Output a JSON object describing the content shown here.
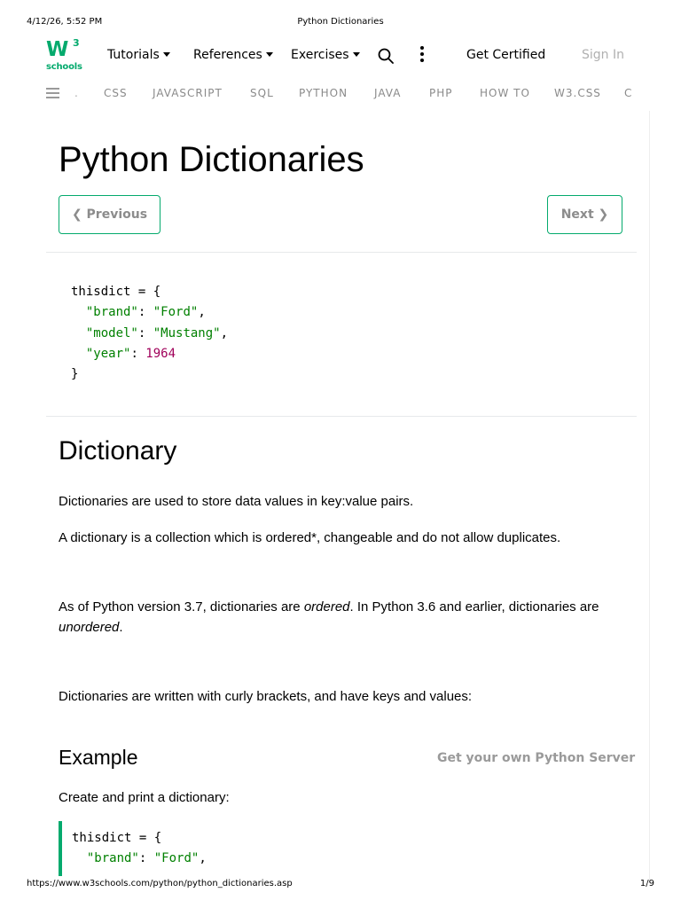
{
  "print_header": {
    "date": "4/12/26, 5:52 PM",
    "title": "Python Dictionaries"
  },
  "logo": {
    "w": "W",
    "sup": "3",
    "schools": "schools"
  },
  "topnav": {
    "tutorials": "Tutorials",
    "references": "References",
    "exercises": "Exercises",
    "get_certified": "Get Certified",
    "sign_in": "Sign In"
  },
  "subnav": {
    "dot": ".",
    "items": [
      "CSS",
      "JAVASCRIPT",
      "SQL",
      "PYTHON",
      "JAVA",
      "PHP",
      "HOW TO",
      "W3.CSS",
      "C"
    ]
  },
  "page": {
    "title": "Python Dictionaries"
  },
  "pager": {
    "previous": "❮ Previous",
    "next": "Next ❯"
  },
  "intro_code": {
    "l1": "thisdict = {",
    "brand_key": "\"brand\"",
    "brand_val": "\"Ford\"",
    "model_key": "\"model\"",
    "model_val": "\"Mustang\"",
    "year_key": "\"year\"",
    "year_val": "1964",
    "close": "}"
  },
  "dictionary": {
    "heading": "Dictionary",
    "p1": "Dictionaries are used to store data values in key:value pairs.",
    "p2": "A dictionary is a collection which is ordered*, changeable and do not allow duplicates.",
    "p3_a": "As of Python version 3.7, dictionaries are ",
    "p3_b": "ordered",
    "p3_c": ". In Python 3.6 and earlier, dictionaries are ",
    "p3_d": "unordered",
    "p3_e": ".",
    "p4": "Dictionaries are written with curly brackets, and have keys and values:"
  },
  "example": {
    "heading": "Example",
    "server_link": "Get your own Python Server",
    "desc": "Create and print a dictionary:",
    "l1": "thisdict = {",
    "brand_key": "\"brand\"",
    "brand_val": "\"Ford\""
  },
  "print_footer": {
    "url": "https://www.w3schools.com/python/python_dictionaries.asp",
    "page": "1/9"
  },
  "colors": {
    "accent": "#04AA6D",
    "string": "#008000",
    "number": "#a0005a"
  }
}
